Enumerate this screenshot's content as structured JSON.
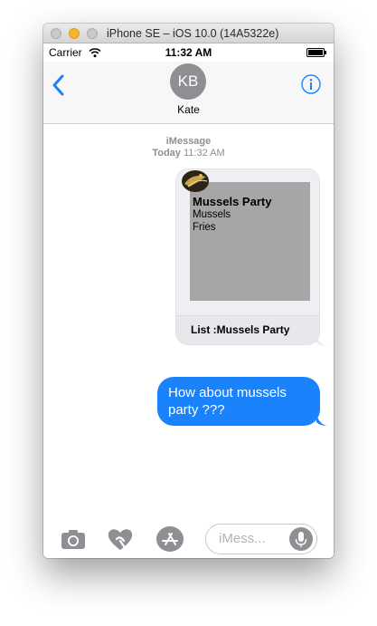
{
  "window": {
    "title": "iPhone SE – iOS 10.0 (14A5322e)"
  },
  "status_bar": {
    "carrier": "Carrier",
    "time": "11:32 AM"
  },
  "nav": {
    "back_icon": "chevron-left-icon",
    "avatar_initials": "KB",
    "contact_name": "Kate",
    "info_icon": "info-icon"
  },
  "conversation": {
    "service": "iMessage",
    "date_day": "Today",
    "date_time": "11:32 AM",
    "card": {
      "title": "Mussels Party",
      "line1": "Mussels",
      "line2": "Fries",
      "caption": "List :Mussels Party"
    },
    "message": "How about mussels party ???"
  },
  "input_bar": {
    "placeholder": "iMess...",
    "icons": [
      "camera-icon",
      "digital-touch-heart-icon",
      "app-store-icon",
      "microphone-icon"
    ]
  },
  "colors": {
    "accent": "#1a82fb",
    "bubble": "#1a82fb",
    "gray_text": "#8e8e93"
  }
}
